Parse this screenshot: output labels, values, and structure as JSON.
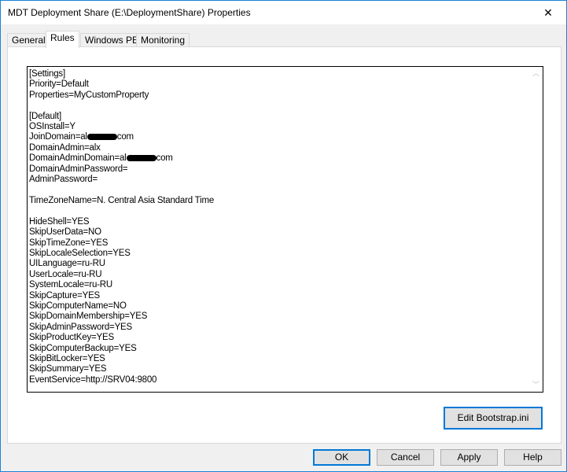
{
  "window": {
    "title": "MDT Deployment Share (E:\\DeploymentShare) Properties",
    "close": "✕"
  },
  "tabs": [
    "General",
    "Rules",
    "Windows PE",
    "Monitoring"
  ],
  "rules": {
    "lines": [
      "[Settings]",
      "Priority=Default",
      "Properties=MyCustomProperty",
      "",
      "[Default]",
      "OSInstall=Y"
    ],
    "join_prefix": "JoinDomain=al",
    "join_suffix": "com",
    "lines2": [
      "DomainAdmin=alx"
    ],
    "dad_prefix": "DomainAdminDomain=al",
    "dad_suffix": "com",
    "lines3": [
      "DomainAdminPassword=",
      "AdminPassword=",
      "",
      "TimeZoneName=N. Central Asia Standard Time",
      "",
      "HideShell=YES",
      "SkipUserData=NO",
      "SkipTimeZone=YES",
      "SkipLocaleSelection=YES",
      "UILanguage=ru-RU",
      "UserLocale=ru-RU",
      "SystemLocale=ru-RU",
      "SkipCapture=YES",
      "SkipComputerName=NO",
      "SkipDomainMembership=YES",
      "SkipAdminPassword=YES",
      "SkipProductKey=YES",
      "SkipComputerBackup=YES",
      "SkipBitLocker=YES",
      "SkipSummary=YES",
      "EventService=http://SRV04:9800"
    ]
  },
  "buttons": {
    "edit_bootstrap": "Edit Bootstrap.ini",
    "ok": "OK",
    "cancel": "Cancel",
    "apply": "Apply",
    "help": "Help"
  }
}
